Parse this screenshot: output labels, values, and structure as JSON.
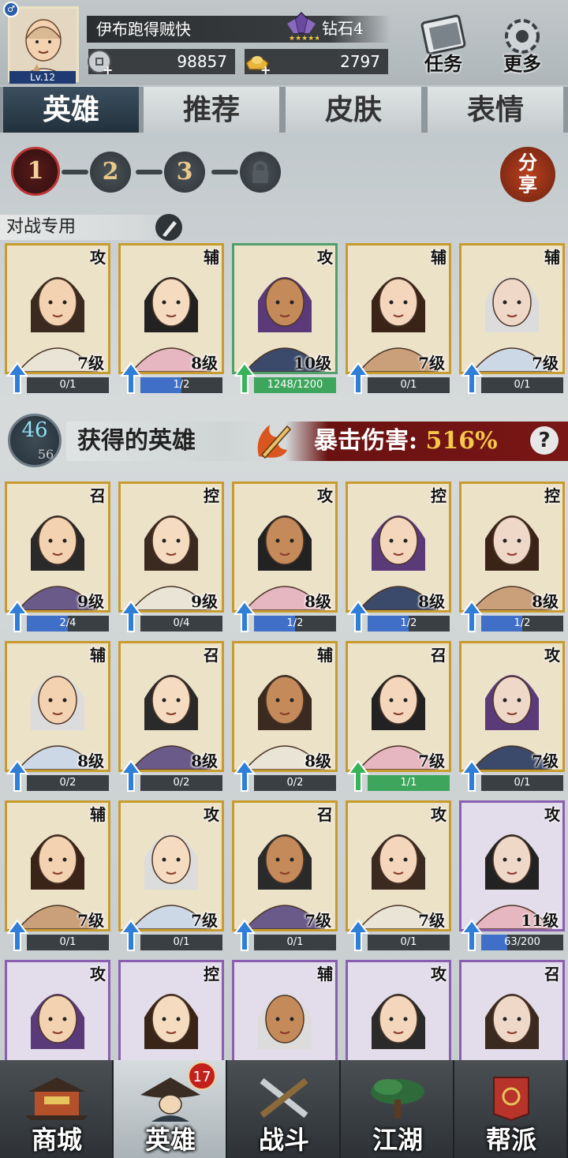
{
  "player": {
    "name": "伊布跑得贼快",
    "level_text": "Lv.12",
    "rank": "钻石4",
    "silver": "98857",
    "gold": "2797"
  },
  "top_buttons": {
    "tasks": "任务",
    "more": "更多"
  },
  "tabs": [
    "英雄",
    "推荐",
    "皮肤",
    "表情"
  ],
  "team_pages": [
    "1",
    "2",
    "3"
  ],
  "share_label": "分享",
  "battle_label": "对战专用",
  "battle_heroes": [
    {
      "role": "攻",
      "level": "7级",
      "progress": "0/1",
      "fill": 0,
      "frame": "gold",
      "arrow": "blue"
    },
    {
      "role": "辅",
      "level": "8级",
      "progress": "1/2",
      "fill": 0.5,
      "frame": "gold",
      "arrow": "blue"
    },
    {
      "role": "攻",
      "level": "10级",
      "progress": "1248/1200",
      "fill": 1,
      "frame": "green",
      "arrow": "green"
    },
    {
      "role": "辅",
      "level": "7级",
      "progress": "0/1",
      "fill": 0,
      "frame": "gold",
      "arrow": "blue"
    },
    {
      "role": "辅",
      "level": "7级",
      "progress": "0/1",
      "fill": 0,
      "frame": "gold",
      "arrow": "blue"
    }
  ],
  "obtained": {
    "count": "46",
    "total": "56",
    "title": "获得的英雄",
    "crit_label": "暴击伤害:",
    "crit_value": "516%",
    "help": "?"
  },
  "heroes": [
    {
      "role": "召",
      "level": "9级",
      "progress": "2/4",
      "fill": 0.5,
      "frame": "gold",
      "arrow": "blue"
    },
    {
      "role": "控",
      "level": "9级",
      "progress": "0/4",
      "fill": 0,
      "frame": "gold",
      "arrow": "blue"
    },
    {
      "role": "攻",
      "level": "8级",
      "progress": "1/2",
      "fill": 0.5,
      "frame": "gold",
      "arrow": "blue"
    },
    {
      "role": "控",
      "level": "8级",
      "progress": "1/2",
      "fill": 0.5,
      "frame": "gold",
      "arrow": "blue"
    },
    {
      "role": "控",
      "level": "8级",
      "progress": "1/2",
      "fill": 0.5,
      "frame": "gold",
      "arrow": "blue"
    },
    {
      "role": "辅",
      "level": "8级",
      "progress": "0/2",
      "fill": 0,
      "frame": "gold",
      "arrow": "blue"
    },
    {
      "role": "召",
      "level": "8级",
      "progress": "0/2",
      "fill": 0,
      "frame": "gold",
      "arrow": "blue"
    },
    {
      "role": "辅",
      "level": "8级",
      "progress": "0/2",
      "fill": 0,
      "frame": "gold",
      "arrow": "blue"
    },
    {
      "role": "召",
      "level": "7级",
      "progress": "1/1",
      "fill": 1,
      "frame": "gold",
      "arrow": "green"
    },
    {
      "role": "攻",
      "level": "7级",
      "progress": "0/1",
      "fill": 0,
      "frame": "gold",
      "arrow": "blue"
    },
    {
      "role": "辅",
      "level": "7级",
      "progress": "0/1",
      "fill": 0,
      "frame": "gold",
      "arrow": "blue"
    },
    {
      "role": "攻",
      "level": "7级",
      "progress": "0/1",
      "fill": 0,
      "frame": "gold",
      "arrow": "blue"
    },
    {
      "role": "召",
      "level": "7级",
      "progress": "0/1",
      "fill": 0,
      "frame": "gold",
      "arrow": "blue"
    },
    {
      "role": "攻",
      "level": "7级",
      "progress": "0/1",
      "fill": 0,
      "frame": "gold",
      "arrow": "blue"
    },
    {
      "role": "攻",
      "level": "11级",
      "progress": "63/200",
      "fill": 0.315,
      "frame": "purple",
      "arrow": "blue"
    },
    {
      "role": "攻",
      "level": "",
      "progress": "",
      "fill": 0,
      "frame": "purple",
      "arrow": ""
    },
    {
      "role": "控",
      "level": "",
      "progress": "",
      "fill": 0,
      "frame": "purple",
      "arrow": ""
    },
    {
      "role": "辅",
      "level": "",
      "progress": "",
      "fill": 0,
      "frame": "purple",
      "arrow": ""
    },
    {
      "role": "攻",
      "level": "",
      "progress": "",
      "fill": 0,
      "frame": "purple",
      "arrow": ""
    },
    {
      "role": "召",
      "level": "",
      "progress": "",
      "fill": 0,
      "frame": "purple",
      "arrow": ""
    }
  ],
  "nav": {
    "items": [
      "商城",
      "英雄",
      "战斗",
      "江湖",
      "帮派"
    ],
    "active_index": 1,
    "hero_badge": "17"
  },
  "colors": {
    "gold_frame": "#c79b2e",
    "purple_frame": "#8a5fb0",
    "green_frame": "#4fa06a",
    "progress_blue": "#3f6fc7",
    "progress_green": "#3ea55d",
    "crit_bg": "#7a1616",
    "crit_value": "#f5c84a"
  }
}
